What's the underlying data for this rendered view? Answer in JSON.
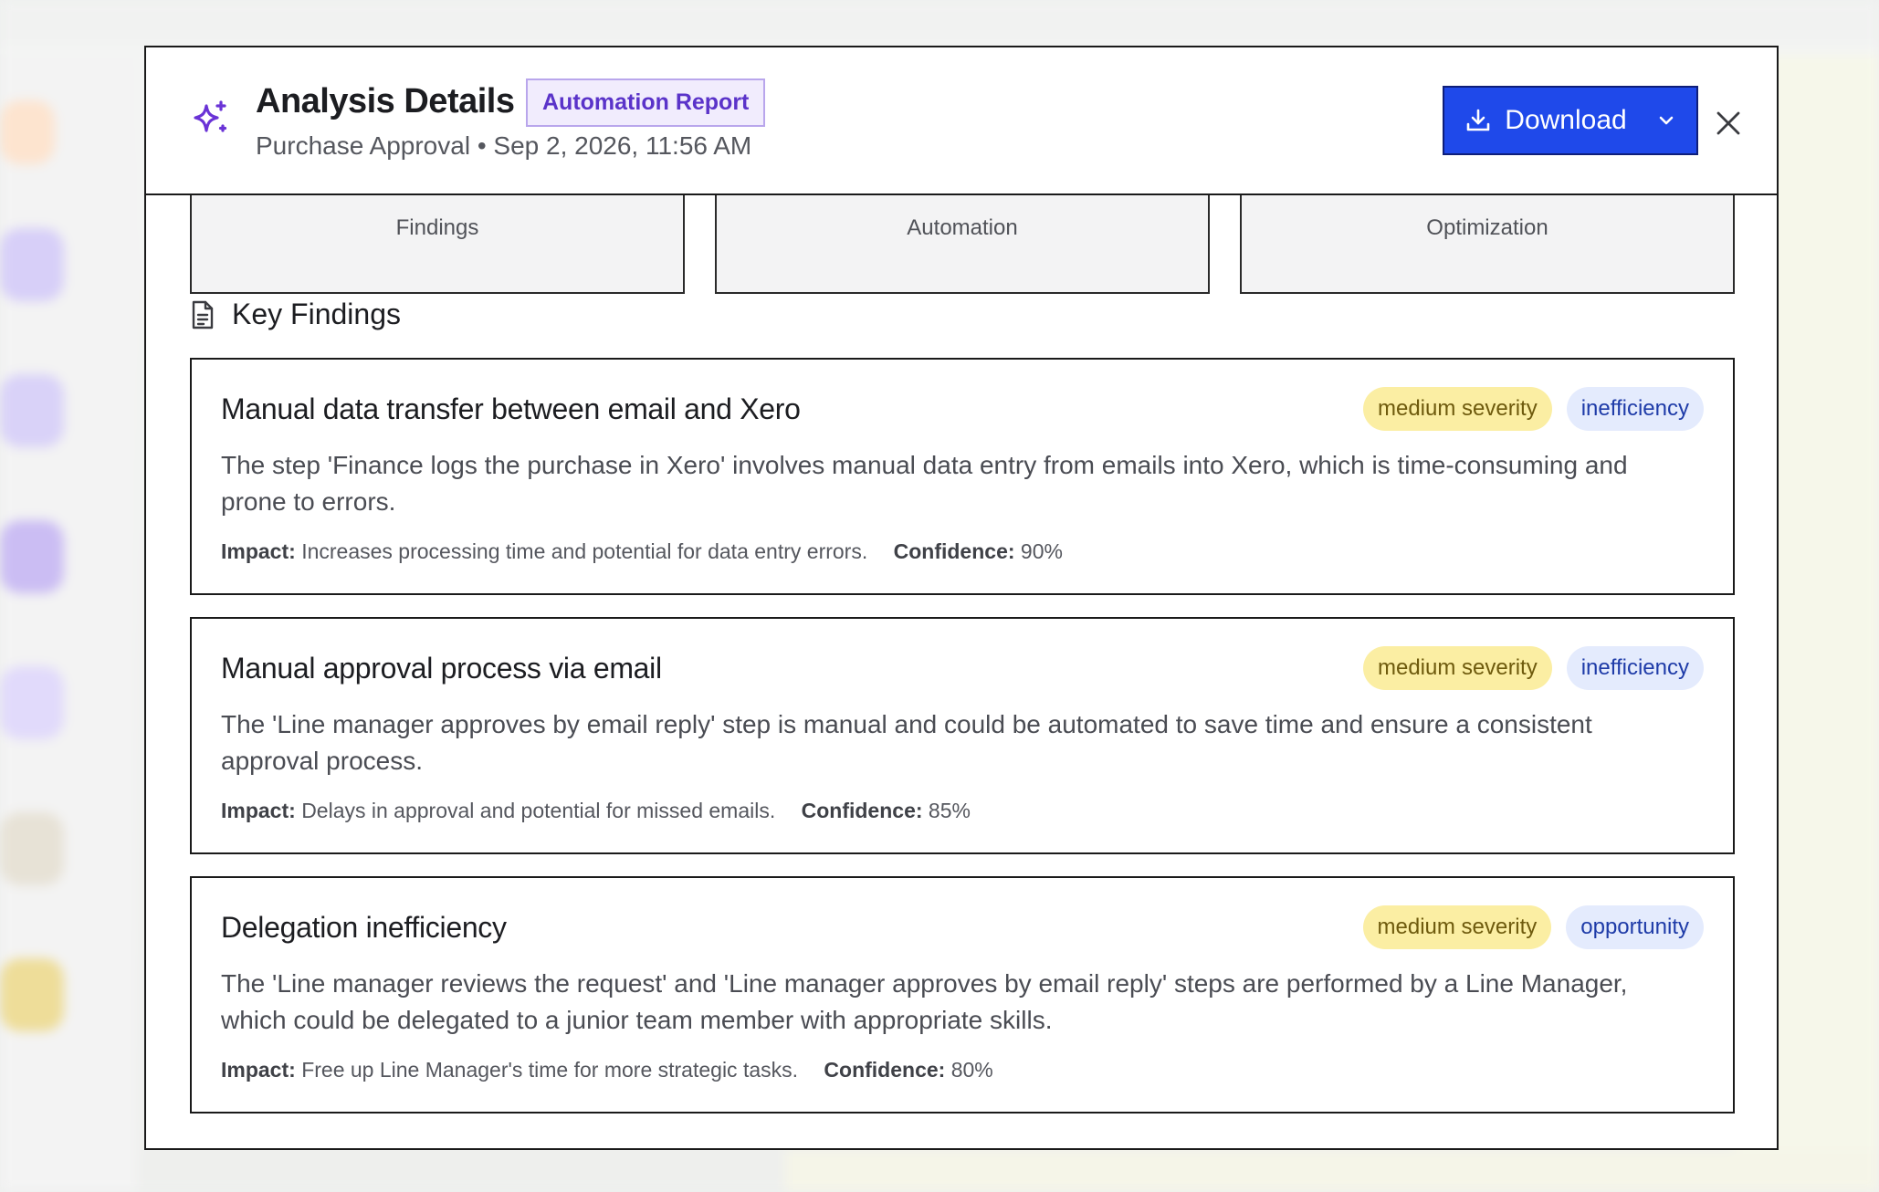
{
  "header": {
    "title": "Analysis Details",
    "badge": "Automation Report",
    "subtitle": "Purchase Approval • Sep 2, 2026, 11:56 AM",
    "download_label": "Download"
  },
  "tabs": [
    {
      "label": "Findings"
    },
    {
      "label": "Automation"
    },
    {
      "label": "Optimization"
    }
  ],
  "section": {
    "title": "Key Findings"
  },
  "labels": {
    "impact": "Impact:",
    "confidence": "Confidence:"
  },
  "findings": [
    {
      "title": "Manual data transfer between email and Xero",
      "severity": "medium severity",
      "category": "inefficiency",
      "description": "The step 'Finance logs the purchase in Xero' involves manual data entry from emails into Xero, which is time-consuming and prone to errors.",
      "impact": "Increases processing time and potential for data entry errors.",
      "confidence": "90%"
    },
    {
      "title": "Manual approval process via email",
      "severity": "medium severity",
      "category": "inefficiency",
      "description": "The 'Line manager approves by email reply' step is manual and could be automated to save time and ensure a consistent approval process.",
      "impact": "Delays in approval and potential for missed emails.",
      "confidence": "85%"
    },
    {
      "title": "Delegation inefficiency",
      "severity": "medium severity",
      "category": "opportunity",
      "description": "The 'Line manager reviews the request' and 'Line manager approves by email reply' steps are performed by a Line Manager, which could be delegated to a junior team member with appropriate skills.",
      "impact": "Free up Line Manager's time for more strategic tasks.",
      "confidence": "80%"
    }
  ],
  "colors": {
    "accent": "#1f49ea",
    "brand_purple": "#5a33c9",
    "severity_bg": "#fbeea3",
    "category_bg": "#e4ebfd"
  },
  "icons": {
    "header": "sparkle-icon",
    "download": "download-icon",
    "dropdown": "chevron-down-icon",
    "close": "close-icon",
    "section": "document-icon"
  }
}
